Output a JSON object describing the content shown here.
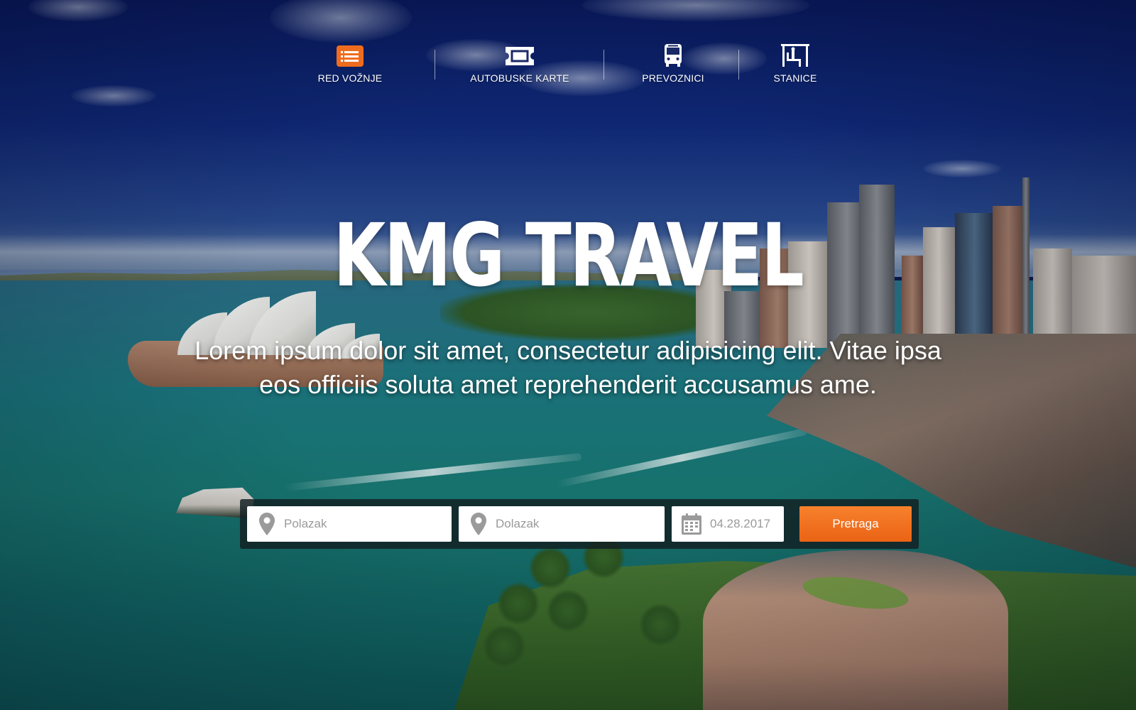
{
  "nav": {
    "items": [
      {
        "label": "RED VOŽNJE",
        "icon": "schedule-list-icon",
        "active": true
      },
      {
        "label": "AUTOBUSKE KARTE",
        "icon": "ticket-icon",
        "active": false
      },
      {
        "label": "PREVOZNICI",
        "icon": "bus-icon",
        "active": false
      },
      {
        "label": "STANICE",
        "icon": "bus-stop-icon",
        "active": false
      }
    ]
  },
  "hero": {
    "title": "KMG TRAVEL",
    "subtitle": "Lorem ipsum dolor sit amet, consectetur adipisicing elit. Vitae ipsa eos officiis soluta amet reprehenderit accusamus ame."
  },
  "search": {
    "departure": {
      "placeholder": "Polazak",
      "icon": "map-pin-icon"
    },
    "arrival": {
      "placeholder": "Dolazak",
      "icon": "map-pin-icon"
    },
    "date": {
      "value": "04.28.2017",
      "icon": "calendar-icon"
    },
    "button_label": "Pretraga"
  },
  "colors": {
    "accent": "#ef6c1e",
    "nav_text": "#ffffff",
    "search_bar_bg": "#121e22"
  }
}
